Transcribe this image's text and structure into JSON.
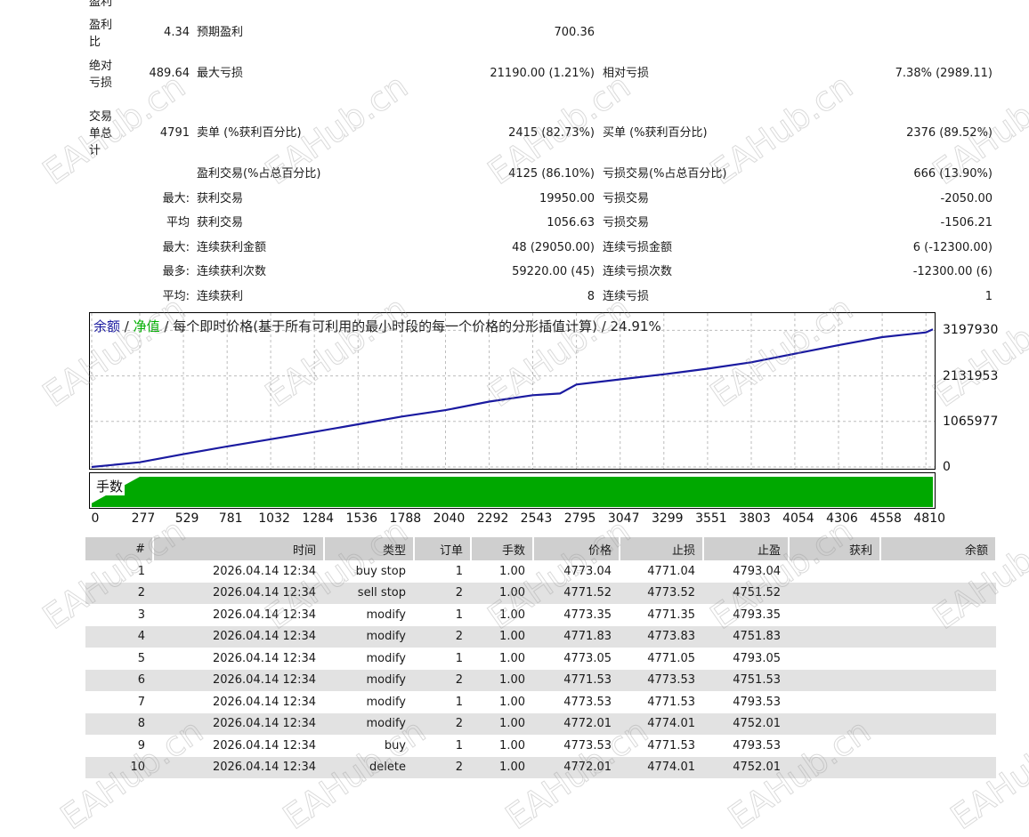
{
  "stats": {
    "cut_label": "盈利",
    "row_profit_factor": {
      "label": "盈利比",
      "value": "4.34",
      "label2": "预期盈利",
      "value2": "700.36"
    },
    "row_abs_dd": {
      "label": "绝对亏损",
      "value": "489.64",
      "label2": "最大亏损",
      "value2": "21190.00 (1.21%)",
      "label3": "相对亏损",
      "value3": "7.38% (2989.11)"
    },
    "row_trades": {
      "label": "交易单总计",
      "value": "4791",
      "label2": "卖单 (%获利百分比)",
      "value2": "2415 (82.73%)",
      "label3": "买单 (%获利百分比)",
      "value3": "2376 (89.52%)"
    },
    "row_win": {
      "label2": "盈利交易(%占总百分比)",
      "value2": "4125 (86.10%)",
      "label3": "亏损交易(%占总百分比)",
      "value3": "666 (13.90%)"
    },
    "row_max": {
      "prefix": "最大:",
      "label2": "获利交易",
      "value2": "19950.00",
      "label3": "亏损交易",
      "value3": "-2050.00"
    },
    "row_avg": {
      "prefix": "平均",
      "label2": "获利交易",
      "value2": "1056.63",
      "label3": "亏损交易",
      "value3": "-1506.21"
    },
    "row_max_consec": {
      "prefix": "最大:",
      "label2": "连续获利金额",
      "value2": "48 (29050.00)",
      "label3": "连续亏损金额",
      "value3": "6 (-12300.00)"
    },
    "row_most_consec": {
      "prefix": "最多:",
      "label2": "连续获利次数",
      "value2": "59220.00 (45)",
      "label3": "连续亏损次数",
      "value3": "-12300.00 (6)"
    },
    "row_avg_consec": {
      "prefix": "平均:",
      "label2": "连续获利",
      "value2": "8",
      "label3": "连续亏损",
      "value3": "1"
    }
  },
  "chart_labels": {
    "balance": "余额",
    "sep1": " / ",
    "equity": "净值",
    "desc": " / 每个即时价格(基于所有可利用的最小时段的每一个价格的分形插值计算) / 24.91%",
    "lots": "手数"
  },
  "colors": {
    "balance": "#1a1aa0",
    "equity": "#00b000",
    "lots": "#00a800",
    "grid": "#bdbdbd",
    "header_bg": "#cfcfcf",
    "row_alt": "#e2e2e2"
  },
  "chart_data": {
    "type": "line",
    "series": [
      {
        "name": "余额",
        "x": [
          0,
          277,
          529,
          781,
          1032,
          1284,
          1536,
          1788,
          2040,
          2292,
          2543,
          2700,
          2795,
          3047,
          3299,
          3551,
          3803,
          4054,
          4306,
          4558,
          4810,
          4850
        ],
        "y": [
          0,
          110000,
          300000,
          480000,
          650000,
          820000,
          1000000,
          1180000,
          1330000,
          1530000,
          1680000,
          1720000,
          1930000,
          2050000,
          2170000,
          2300000,
          2450000,
          2650000,
          2850000,
          3040000,
          3150000,
          3220000
        ]
      }
    ],
    "lots_series": {
      "name": "手数",
      "x": [
        0,
        277,
        4850
      ],
      "y": [
        0.1,
        1.0,
        1.0
      ]
    },
    "yticks": [
      "3197930",
      "2131953",
      "1065977",
      "0"
    ],
    "ytick_values": [
      3197930,
      2131953,
      1065977,
      0
    ],
    "xticks": [
      "0",
      "277",
      "529",
      "781",
      "1032",
      "1284",
      "1536",
      "1788",
      "2040",
      "2292",
      "2543",
      "2795",
      "3047",
      "3299",
      "3551",
      "3803",
      "4054",
      "4306",
      "4558",
      "4810"
    ],
    "xlim": [
      0,
      4850
    ],
    "ylim": [
      0,
      3560000
    ],
    "grid": true
  },
  "table": {
    "headers": [
      "#",
      "时间",
      "类型",
      "订单",
      "手数",
      "价格",
      "止损",
      "止盈",
      "获利",
      "余额"
    ],
    "rows": [
      [
        "1",
        "2026.04.14 12:34",
        "buy stop",
        "1",
        "1.00",
        "4773.04",
        "4771.04",
        "4793.04",
        "",
        ""
      ],
      [
        "2",
        "2026.04.14 12:34",
        "sell stop",
        "2",
        "1.00",
        "4771.52",
        "4773.52",
        "4751.52",
        "",
        ""
      ],
      [
        "3",
        "2026.04.14 12:34",
        "modify",
        "1",
        "1.00",
        "4773.35",
        "4771.35",
        "4793.35",
        "",
        ""
      ],
      [
        "4",
        "2026.04.14 12:34",
        "modify",
        "2",
        "1.00",
        "4771.83",
        "4773.83",
        "4751.83",
        "",
        ""
      ],
      [
        "5",
        "2026.04.14 12:34",
        "modify",
        "1",
        "1.00",
        "4773.05",
        "4771.05",
        "4793.05",
        "",
        ""
      ],
      [
        "6",
        "2026.04.14 12:34",
        "modify",
        "2",
        "1.00",
        "4771.53",
        "4773.53",
        "4751.53",
        "",
        ""
      ],
      [
        "7",
        "2026.04.14 12:34",
        "modify",
        "1",
        "1.00",
        "4773.53",
        "4771.53",
        "4793.53",
        "",
        ""
      ],
      [
        "8",
        "2026.04.14 12:34",
        "modify",
        "2",
        "1.00",
        "4772.01",
        "4774.01",
        "4752.01",
        "",
        ""
      ],
      [
        "9",
        "2026.04.14 12:34",
        "buy",
        "1",
        "1.00",
        "4773.53",
        "4771.53",
        "4793.53",
        "",
        ""
      ],
      [
        "10",
        "2026.04.14 12:34",
        "delete",
        "2",
        "1.00",
        "4772.01",
        "4774.01",
        "4752.01",
        "",
        ""
      ]
    ]
  },
  "watermark": "EAHub.cn"
}
